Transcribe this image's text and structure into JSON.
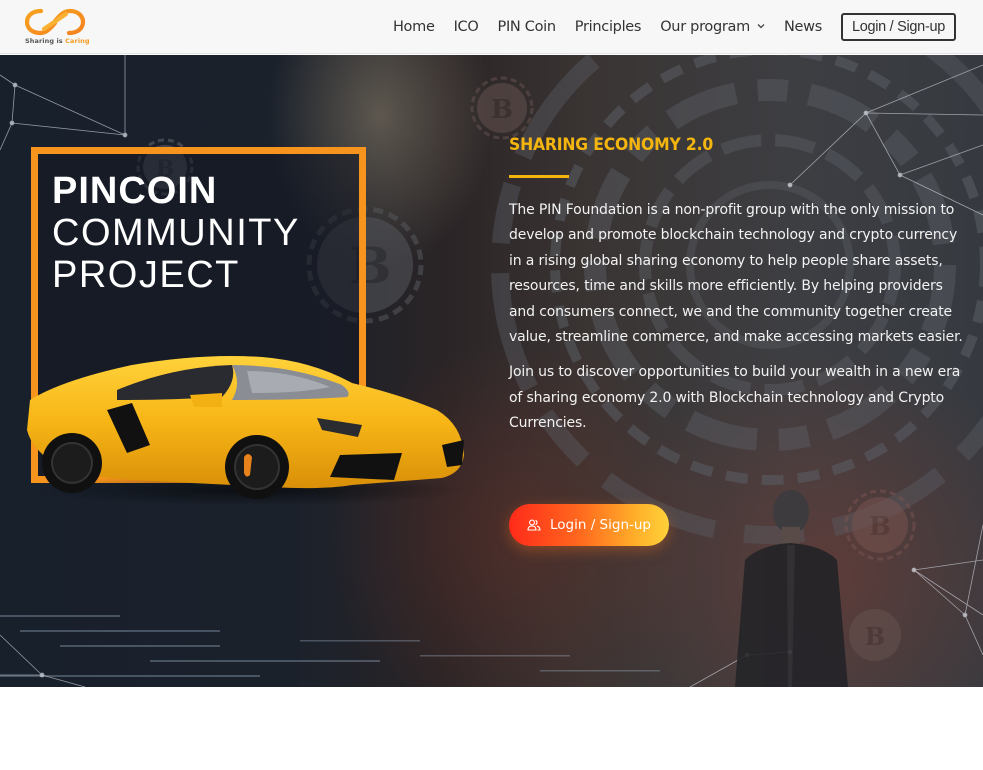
{
  "header": {
    "logo": {
      "icon": "infinity-loop-icon",
      "tagline_part1": "Sharing is",
      "tagline_part2": "Caring"
    },
    "nav": [
      {
        "label": "Home"
      },
      {
        "label": "ICO"
      },
      {
        "label": "PIN Coin"
      },
      {
        "label": "Principles"
      },
      {
        "label": "Our program",
        "has_dropdown": true,
        "icon": "chevron-down-icon"
      },
      {
        "label": "News"
      }
    ],
    "login_label": "Login / Sign-up"
  },
  "hero": {
    "project_title": {
      "line1": "PINCOIN",
      "line2": "COMMUNITY",
      "line3": "PROJECT"
    },
    "car_image": "yellow-sports-car",
    "kicker": "SHARING ECONOMY 2.0",
    "paragraphs": [
      "The PIN Foundation is a non-profit group with the only mission to develop and promote blockchain technology and crypto currency in a rising global sharing economy to help people share assets, resources, time and skills more efficiently. By helping providers and consumers connect, we and the community together create value, streamline commerce, and make accessing markets easier.",
      "Join us to discover opportunities to build your wealth in a new era of sharing economy 2.0 with Blockchain technology and Crypto Currencies."
    ],
    "cta": {
      "icon": "users-icon",
      "label": "Login / Sign-up"
    }
  },
  "colors": {
    "accent_orange": "#f7941d",
    "kicker_yellow": "#f5b50f",
    "cta_gradient_start": "#ff2a1a",
    "cta_gradient_end": "#ffd23a",
    "header_bg": "#f7f7f7",
    "nav_text": "#333333"
  }
}
